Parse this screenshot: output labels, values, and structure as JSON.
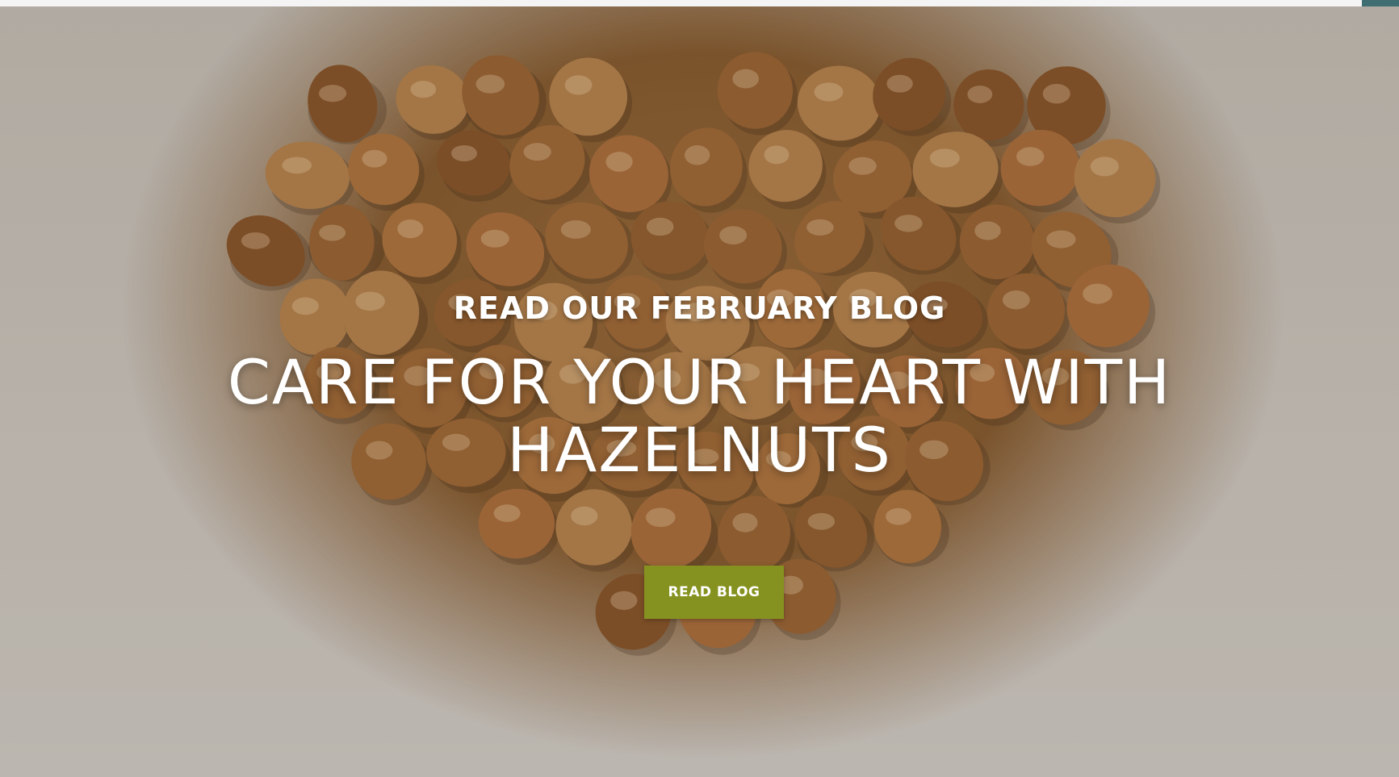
{
  "hero": {
    "eyebrow": "READ OUR FEBRUARY BLOG",
    "headline": "CARE FOR YOUR HEART WITH HAZELNUTS",
    "cta_label": "READ BLOG"
  },
  "colors": {
    "cta_background": "#86921f",
    "accent_strip": "#3f6e72",
    "text": "#ffffff"
  }
}
